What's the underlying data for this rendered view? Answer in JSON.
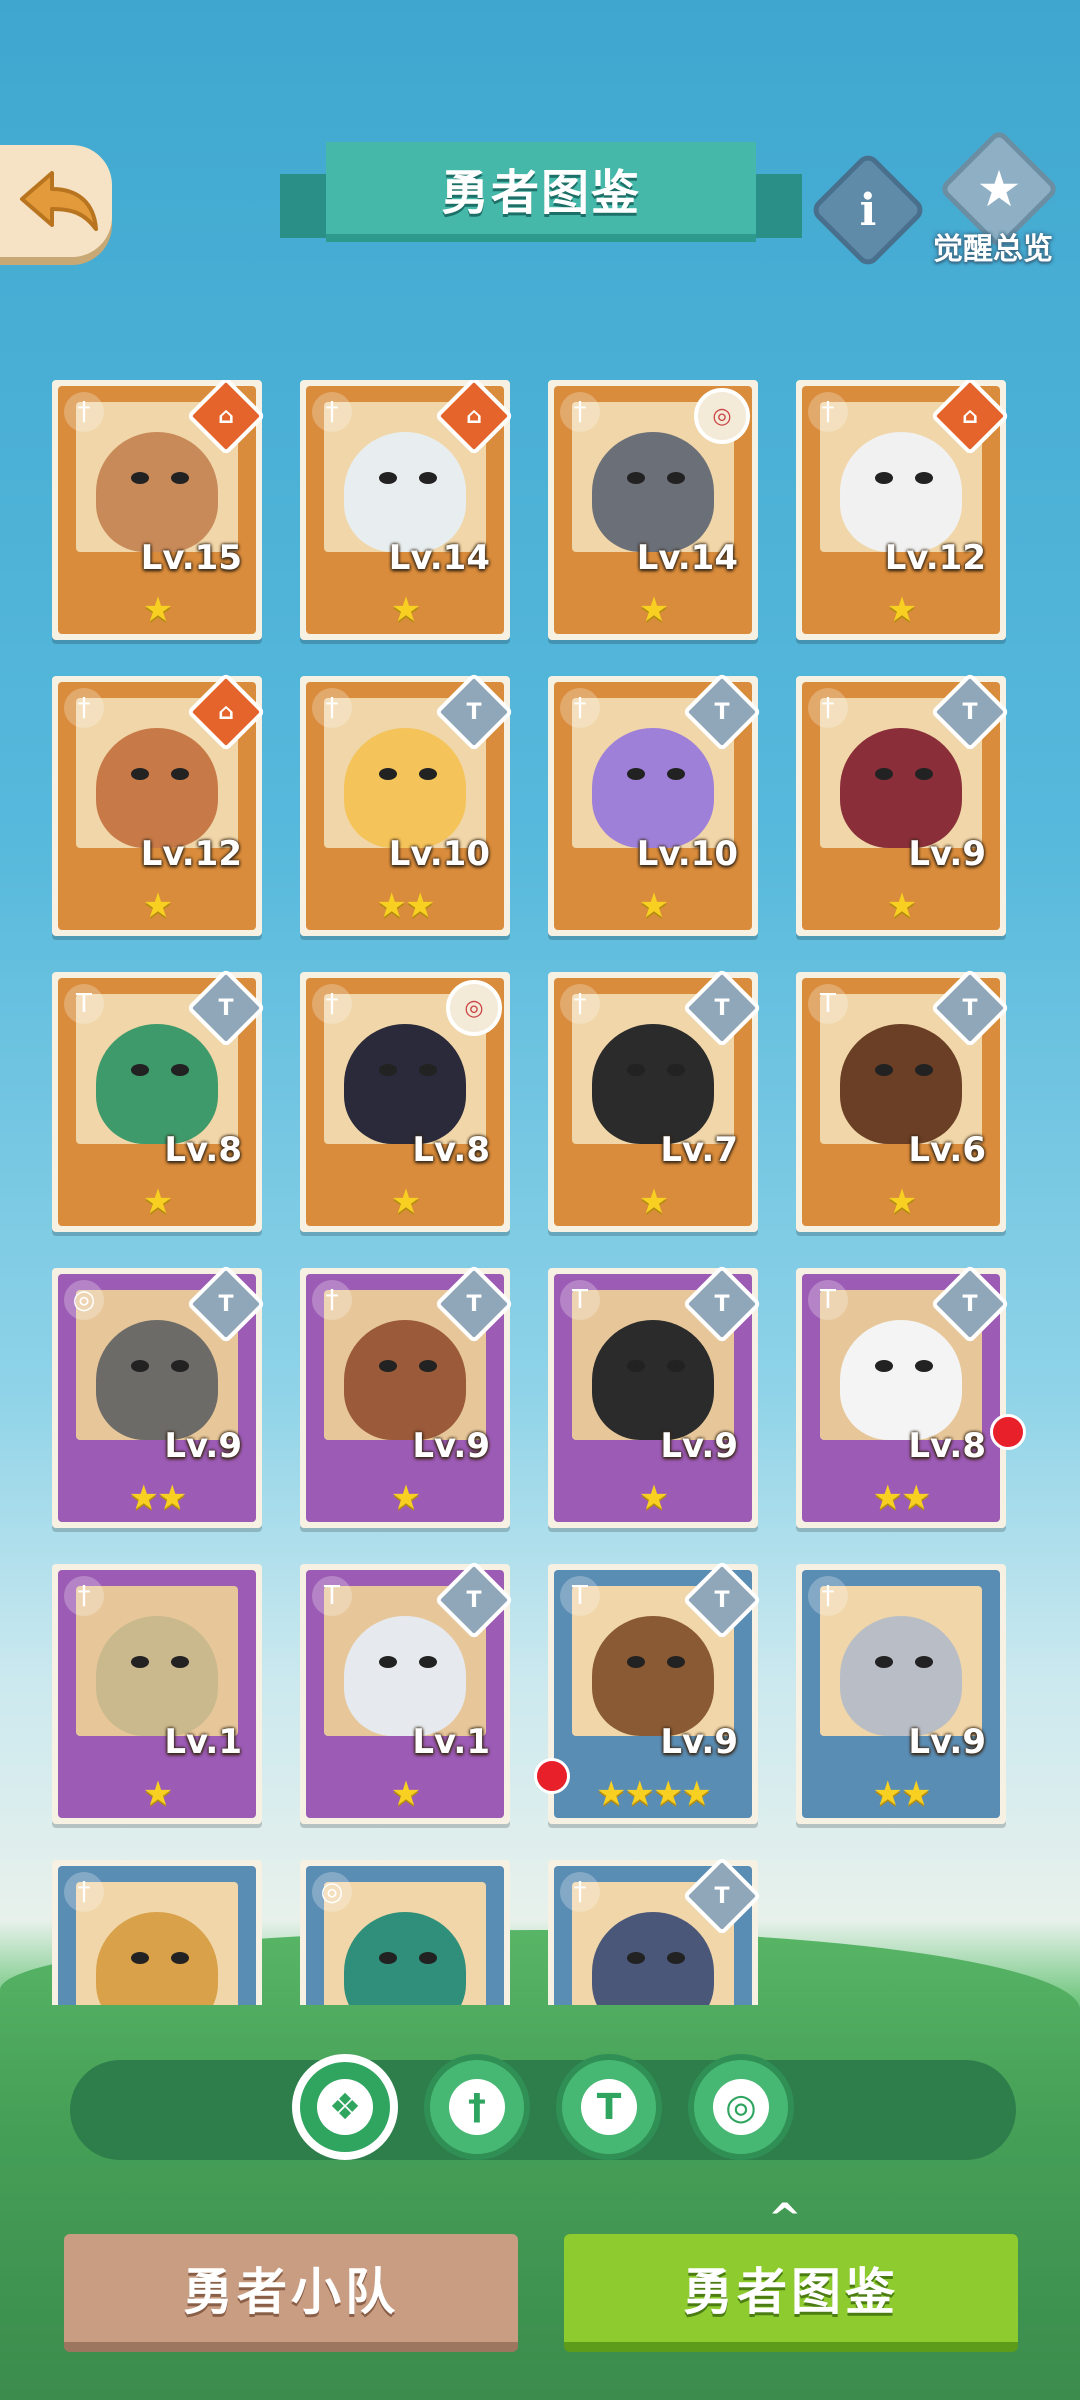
{
  "header": {
    "title": "勇者图鉴",
    "awakening_label": "觉醒总览",
    "info_glyph": "i"
  },
  "icons": {
    "back": "back-arrow-icon",
    "info": "info-icon",
    "awakening": "star-icon",
    "sword": "sword-icon",
    "hammer": "hammer-icon",
    "compass": "compass-icon",
    "all": "diamond-cluster-icon"
  },
  "colors": {
    "orange_card": "#d98c3b",
    "purple_card": "#9c5bb5",
    "blue_card": "#5a8db4",
    "star": "#f7d021",
    "team_tab": "#c89d82",
    "codex_tab": "#8dcb2f"
  },
  "heroes": [
    {
      "level": "Lv.15",
      "stars": "★",
      "rarity": "orange",
      "class": "sword",
      "badge": "helmet"
    },
    {
      "level": "Lv.14",
      "stars": "★",
      "rarity": "orange",
      "class": "sword",
      "badge": "helmet"
    },
    {
      "level": "Lv.14",
      "stars": "★",
      "rarity": "orange",
      "class": "sword",
      "badge": "compass"
    },
    {
      "level": "Lv.12",
      "stars": "★",
      "rarity": "orange",
      "class": "sword",
      "badge": "helmet"
    },
    {
      "level": "Lv.12",
      "stars": "★",
      "rarity": "orange",
      "class": "sword",
      "badge": "helmet"
    },
    {
      "level": "Lv.10",
      "stars": "★★",
      "rarity": "orange",
      "class": "sword",
      "badge": "tool"
    },
    {
      "level": "Lv.10",
      "stars": "★",
      "rarity": "orange",
      "class": "sword",
      "badge": "tool"
    },
    {
      "level": "Lv.9",
      "stars": "★",
      "rarity": "orange",
      "class": "sword",
      "badge": "tool"
    },
    {
      "level": "Lv.8",
      "stars": "★",
      "rarity": "orange",
      "class": "hammer",
      "badge": "tool"
    },
    {
      "level": "Lv.8",
      "stars": "★",
      "rarity": "orange",
      "class": "sword",
      "badge": "compass"
    },
    {
      "level": "Lv.7",
      "stars": "★",
      "rarity": "orange",
      "class": "sword",
      "badge": "tool"
    },
    {
      "level": "Lv.6",
      "stars": "★",
      "rarity": "orange",
      "class": "hammer",
      "badge": "tool"
    },
    {
      "level": "Lv.9",
      "stars": "★★",
      "rarity": "purple",
      "class": "compass",
      "badge": "tool"
    },
    {
      "level": "Lv.9",
      "stars": "★",
      "rarity": "purple",
      "class": "sword",
      "badge": "tool"
    },
    {
      "level": "Lv.9",
      "stars": "★",
      "rarity": "purple",
      "class": "hammer",
      "badge": "tool"
    },
    {
      "level": "Lv.8",
      "stars": "★★",
      "rarity": "purple",
      "class": "hammer",
      "badge": "tool"
    },
    {
      "level": "Lv.1",
      "stars": "★",
      "rarity": "purple",
      "class": "sword",
      "badge": "none"
    },
    {
      "level": "Lv.1",
      "stars": "★",
      "rarity": "purple",
      "class": "hammer",
      "badge": "tool"
    },
    {
      "level": "Lv.9",
      "stars": "★★★★",
      "rarity": "blue",
      "class": "hammer",
      "badge": "tool"
    },
    {
      "level": "Lv.9",
      "stars": "★★",
      "rarity": "blue",
      "class": "sword",
      "badge": "none"
    },
    {
      "level": "",
      "stars": "",
      "rarity": "blue",
      "class": "sword",
      "badge": "none"
    },
    {
      "level": "",
      "stars": "",
      "rarity": "blue",
      "class": "compass",
      "badge": "none"
    },
    {
      "level": "",
      "stars": "",
      "rarity": "blue",
      "class": "sword",
      "badge": "tool"
    }
  ],
  "filters": [
    {
      "name": "all",
      "active": true
    },
    {
      "name": "sword",
      "active": false
    },
    {
      "name": "hammer",
      "active": false
    },
    {
      "name": "compass",
      "active": false
    }
  ],
  "tabs": {
    "team": "勇者小队",
    "codex": "勇者图鉴",
    "chevron": "^"
  }
}
